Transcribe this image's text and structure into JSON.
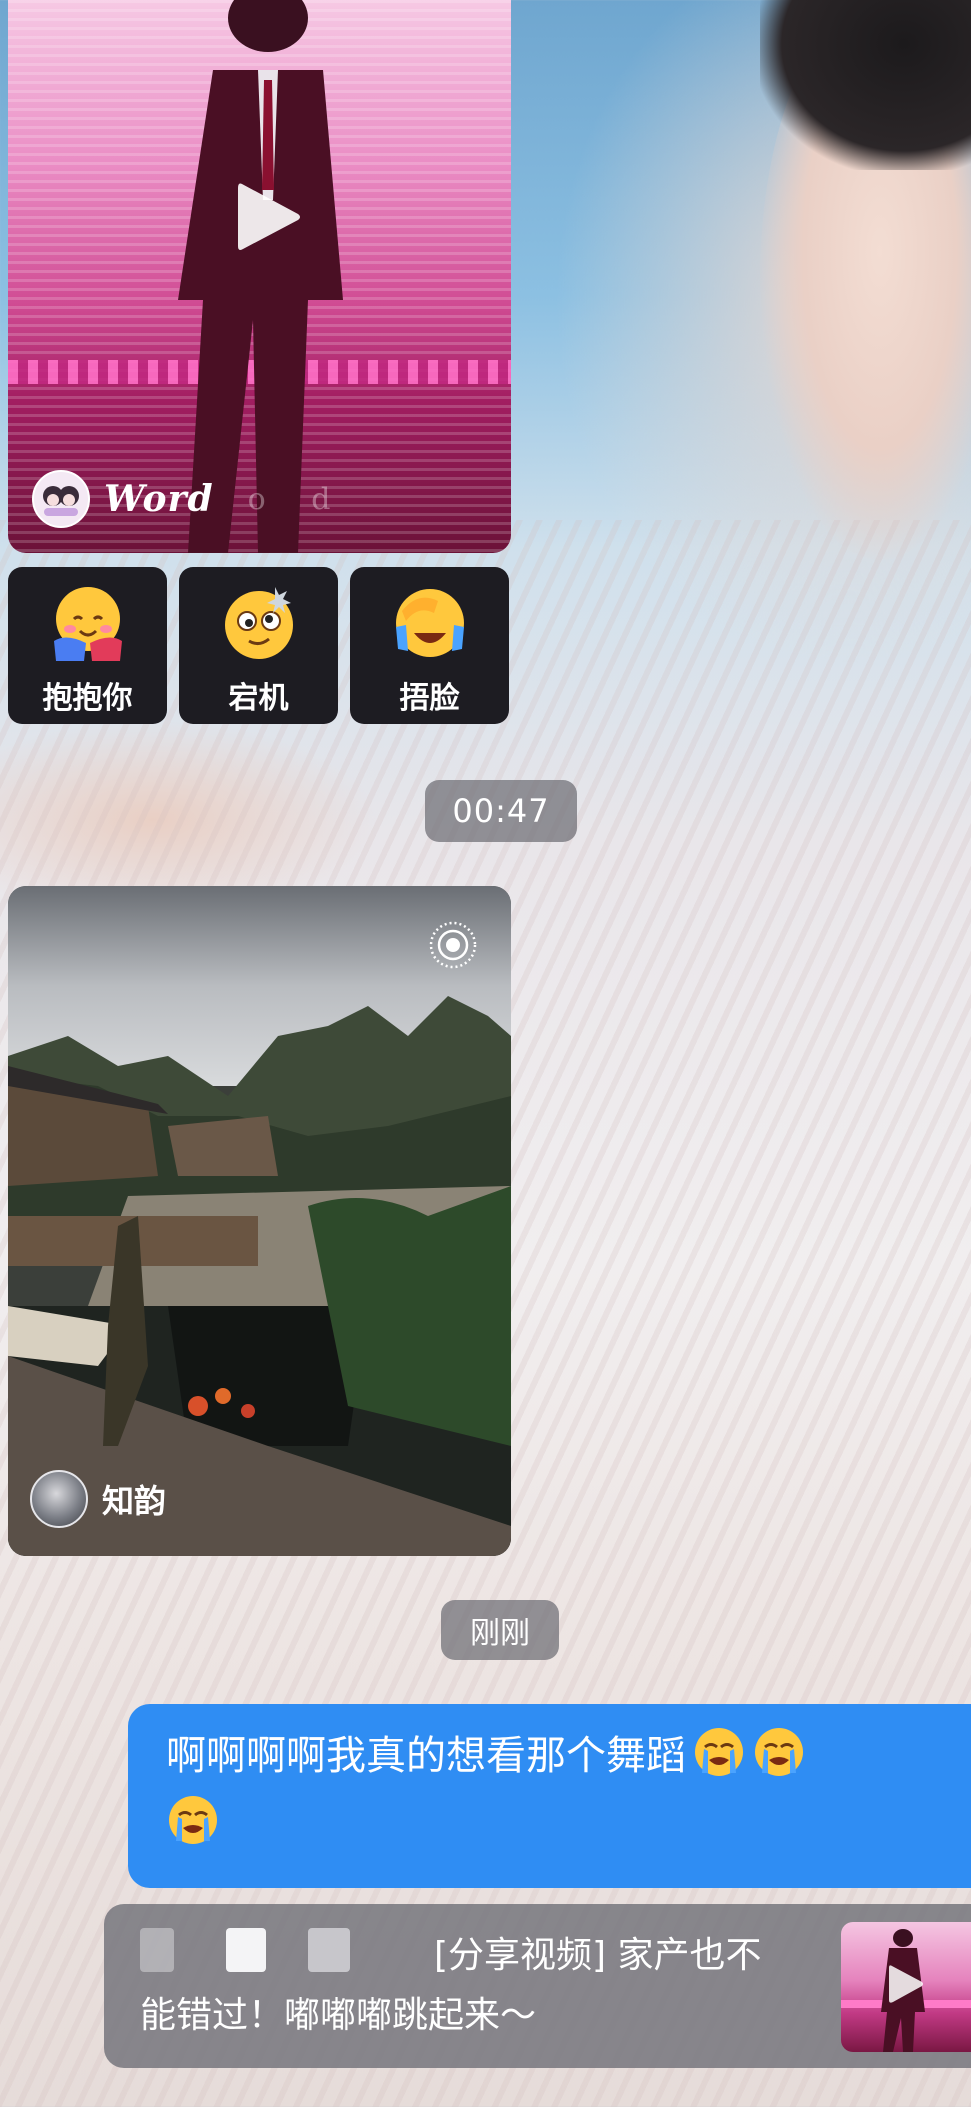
{
  "video_card": {
    "author_name": "Word",
    "author_ghost_text": "o  d"
  },
  "stickers": [
    {
      "label": "抱抱你",
      "icon": "hug-emoji"
    },
    {
      "label": "宕机",
      "icon": "dizzy-emoji"
    },
    {
      "label": "捂脸",
      "icon": "facepalm-emoji"
    }
  ],
  "timestamps": {
    "first": "00:47",
    "second": "刚刚"
  },
  "photo_card": {
    "author_name": "知韵",
    "live_icon": "live-photo-icon"
  },
  "outgoing_message": {
    "text": "啊啊啊啊我真的想看那个舞蹈",
    "emoji": "loudly-crying-emoji",
    "emoji_count": 3
  },
  "share_message": {
    "tag": "[分享视频]",
    "text_line1_tail": "家产也不",
    "text_line2": "能错过！嘟嘟嘟跳起来～"
  },
  "colors": {
    "bubble_blue": "#2f8df3",
    "sticker_bg": "#1d1c22",
    "pill_gray": "#6e6e74"
  }
}
